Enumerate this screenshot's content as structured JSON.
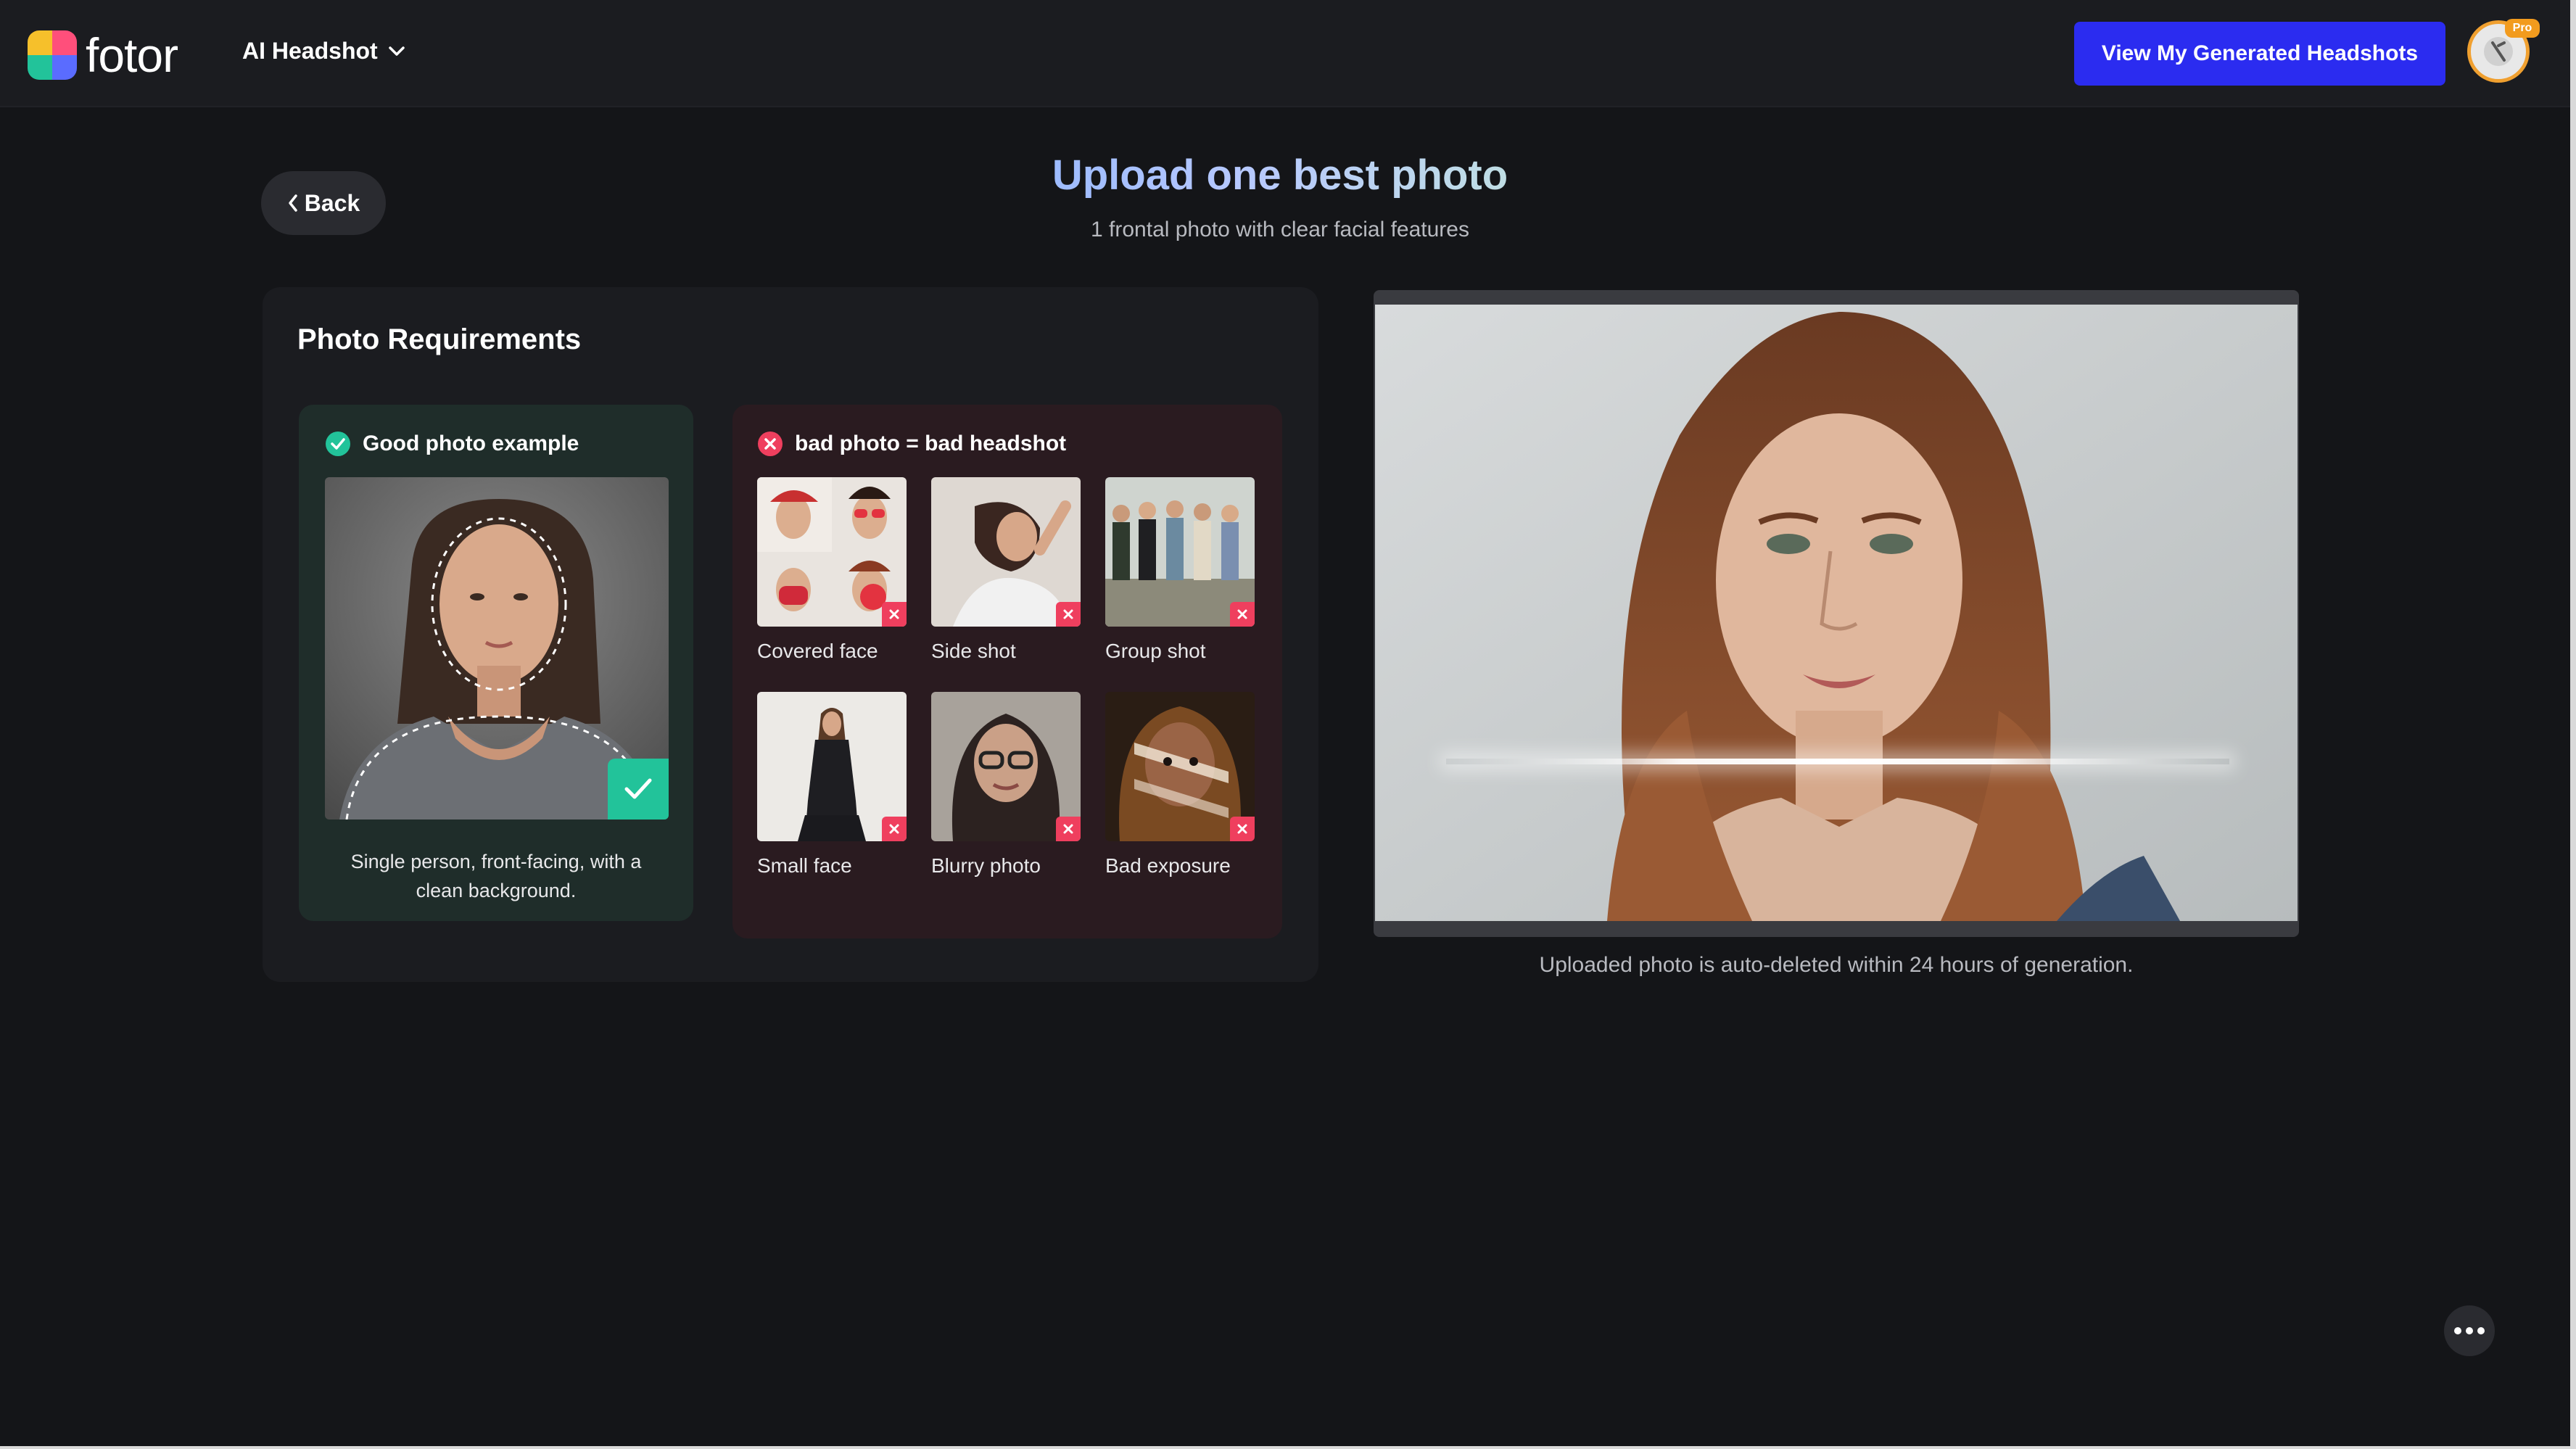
{
  "header": {
    "logo_text": "fotor",
    "nav_dropdown_label": "AI Headshot",
    "cta_label": "View My Generated Headshots",
    "avatar_badge": "Pro"
  },
  "page": {
    "back_label": "Back",
    "title": "Upload one best photo",
    "subtitle": "1 frontal photo with clear facial features"
  },
  "requirements": {
    "title": "Photo Requirements",
    "good": {
      "heading": "Good photo example",
      "caption_line1": "Single person, front-facing, with a",
      "caption_line2": "clean background."
    },
    "bad": {
      "heading": "bad photo = bad headshot",
      "items": [
        {
          "label": "Covered face"
        },
        {
          "label": "Side shot"
        },
        {
          "label": "Group shot"
        },
        {
          "label": "Small face"
        },
        {
          "label": "Blurry photo"
        },
        {
          "label": "Bad exposure"
        }
      ]
    }
  },
  "preview": {
    "note": "Uploaded photo is auto-deleted within 24 hours of generation."
  },
  "colors": {
    "accent_blue": "#2b2cf0",
    "good_green": "#22c39a",
    "bad_red": "#ef3f5e"
  }
}
